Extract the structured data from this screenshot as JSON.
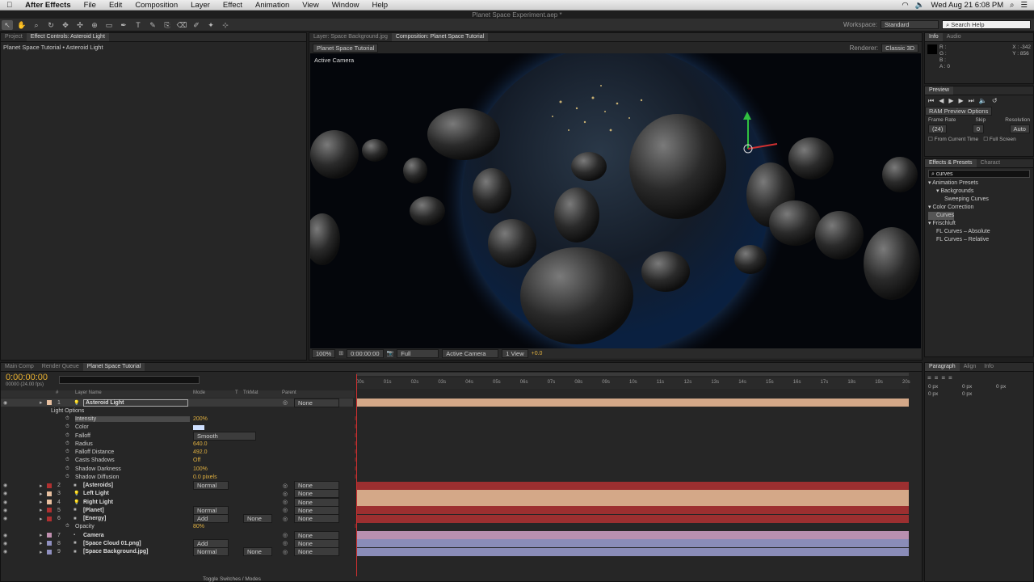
{
  "menubar": {
    "apple": "",
    "app": "After Effects",
    "items": [
      "File",
      "Edit",
      "Composition",
      "Layer",
      "Effect",
      "Animation",
      "View",
      "Window",
      "Help"
    ],
    "clock": "Wed Aug 21  6:08 PM"
  },
  "document_title": "Planet Space Experiment.aep *",
  "toolbar": {
    "workspace_label": "Workspace:",
    "workspace_value": "Standard",
    "search_placeholder": "Search Help"
  },
  "left_panel": {
    "tabs": [
      "Project",
      "Effect Controls: Asteroid Light"
    ],
    "breadcrumb": "Planet Space Tutorial • Asteroid Light"
  },
  "comp_panel": {
    "tabs": [
      "Layer: Space Background.jpg",
      "Composition: Planet Space Tutorial"
    ],
    "comp_button": "Planet Space Tutorial",
    "renderer_label": "Renderer:",
    "renderer_value": "Classic 3D",
    "view_label": "Active Camera",
    "footer": {
      "zoom": "100%",
      "timecode": "0:00:00:00",
      "resolution": "Full",
      "camera": "Active Camera",
      "views": "1 View",
      "exposure": "+0.0"
    }
  },
  "info_panel": {
    "tabs": [
      "Info",
      "Audio"
    ],
    "rgba": [
      "R :",
      "G :",
      "B :",
      "A : 0"
    ],
    "x": "X : -342",
    "y": "Y : 856"
  },
  "preview_panel": {
    "tab": "Preview",
    "ram_options": "RAM Preview Options",
    "frame_rate_label": "Frame Rate",
    "skip_label": "Skip",
    "resolution_label": "Resolution",
    "frame_rate": "(24)",
    "skip": "0",
    "resolution": "Auto",
    "from_current": "From Current Time",
    "full_screen": "Full Screen"
  },
  "effects_panel": {
    "tabs": [
      "Effects & Presets",
      "Charact"
    ],
    "search": "curves",
    "tree": [
      {
        "label": "▾ Animation Presets",
        "indent": 0
      },
      {
        "label": "▾ Backgrounds",
        "indent": 1
      },
      {
        "label": "Sweeping Curves",
        "indent": 2
      },
      {
        "label": "▾ Color Correction",
        "indent": 0
      },
      {
        "label": "Curves",
        "indent": 1,
        "selected": true
      },
      {
        "label": "▾ Frischluft",
        "indent": 0
      },
      {
        "label": "FL Curves – Absolute",
        "indent": 1
      },
      {
        "label": "FL Curves – Relative",
        "indent": 1
      }
    ]
  },
  "paragraph_panel": {
    "tabs": [
      "Paragraph",
      "Align",
      "Info"
    ],
    "values": [
      "0 px",
      "0 px",
      "0 px",
      "0 px",
      "0 px"
    ]
  },
  "timeline": {
    "tabs": [
      "Main Comp",
      "Render Queue",
      "Planet Space Tutorial"
    ],
    "timecode": "0:00:00:00",
    "fps": "00000 (24.00 fps)",
    "headers": {
      "num": "#",
      "name": "Layer Name",
      "mode": "Mode",
      "t": "T",
      "trkmat": "TrkMat",
      "parent": "Parent"
    },
    "ruler": [
      "00s",
      "01s",
      "02s",
      "03s",
      "04s",
      "05s",
      "06s",
      "07s",
      "08s",
      "09s",
      "10s",
      "11s",
      "12s",
      "13s",
      "14s",
      "15s",
      "16s",
      "17s",
      "18s",
      "19s",
      "20s"
    ],
    "rows": [
      {
        "kind": "layer",
        "num": "1",
        "name": "Asteroid Light",
        "mode": "",
        "trkmat": "",
        "parent": "None",
        "color": "#e8c0a0",
        "track": "#d4a888",
        "selected": true,
        "icon": "light"
      },
      {
        "kind": "group",
        "name": "Light Options"
      },
      {
        "kind": "prop",
        "name": "Intensity",
        "value": "200%",
        "hl": true
      },
      {
        "kind": "prop",
        "name": "Color",
        "value": "",
        "swatch": true
      },
      {
        "kind": "prop",
        "name": "Falloff",
        "value": "Smooth",
        "dropdown": true
      },
      {
        "kind": "prop",
        "name": "Radius",
        "value": "640.0"
      },
      {
        "kind": "prop",
        "name": "Falloff Distance",
        "value": "492.0"
      },
      {
        "kind": "prop",
        "name": "Casts Shadows",
        "value": "Off",
        "plain": true
      },
      {
        "kind": "prop",
        "name": "Shadow Darkness",
        "value": "100%"
      },
      {
        "kind": "prop",
        "name": "Shadow Diffusion",
        "value": "0.0 pixels"
      },
      {
        "kind": "layer",
        "num": "2",
        "name": "[Asteroids]",
        "mode": "Normal",
        "trkmat": "",
        "parent": "None",
        "color": "#b03030",
        "track": "#9c2f30"
      },
      {
        "kind": "layer",
        "num": "3",
        "name": "Left Light",
        "mode": "",
        "trkmat": "",
        "parent": "None",
        "color": "#e8c0a0",
        "track": "#d4a888",
        "icon": "light"
      },
      {
        "kind": "layer",
        "num": "4",
        "name": "Right Light",
        "mode": "",
        "trkmat": "",
        "parent": "None",
        "color": "#e8c0a0",
        "track": "#d4a888",
        "icon": "light"
      },
      {
        "kind": "layer",
        "num": "5",
        "name": "[Planet]",
        "mode": "Normal",
        "trkmat": "",
        "parent": "None",
        "color": "#b03030",
        "track": "#9c2f30"
      },
      {
        "kind": "layer",
        "num": "6",
        "name": "[Energy]",
        "mode": "Add",
        "trkmat": "None",
        "parent": "None",
        "color": "#b03030",
        "track": "#9c2f30"
      },
      {
        "kind": "prop",
        "name": "Opacity",
        "value": "80%"
      },
      {
        "kind": "layer",
        "num": "7",
        "name": "Camera",
        "mode": "",
        "trkmat": "",
        "parent": "None",
        "color": "#c090b0",
        "track": "#b890b0",
        "icon": "camera"
      },
      {
        "kind": "layer",
        "num": "8",
        "name": "[Space Cloud 01.png]",
        "mode": "Add",
        "trkmat": "",
        "parent": "None",
        "color": "#9090c0",
        "track": "#8a8cb8"
      },
      {
        "kind": "layer",
        "num": "9",
        "name": "[Space Background.jpg]",
        "mode": "Normal",
        "trkmat": "None",
        "parent": "None",
        "color": "#9090c0",
        "track": "#8a8cb8"
      }
    ],
    "toggle_label": "Toggle Switches / Modes"
  }
}
